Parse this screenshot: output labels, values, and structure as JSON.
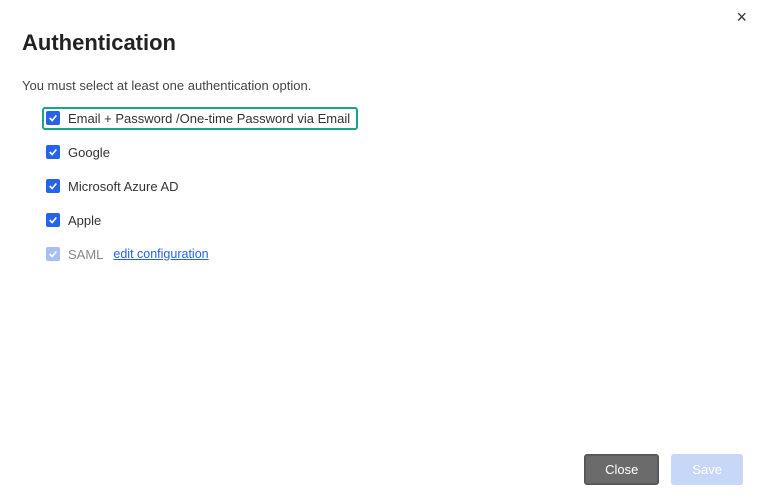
{
  "close_icon": "×",
  "title": "Authentication",
  "subtitle": "You must select at least one authentication option.",
  "options": {
    "email": {
      "label": "Email + Password /One-time Password via Email",
      "checked": true,
      "highlighted": true
    },
    "google": {
      "label": "Google",
      "checked": true
    },
    "azure": {
      "label": "Microsoft Azure AD",
      "checked": true
    },
    "apple": {
      "label": "Apple",
      "checked": true
    },
    "saml": {
      "label": "SAML",
      "checked": true,
      "disabled": true,
      "link_label": "edit configuration"
    }
  },
  "buttons": {
    "close": "Close",
    "save": "Save"
  }
}
